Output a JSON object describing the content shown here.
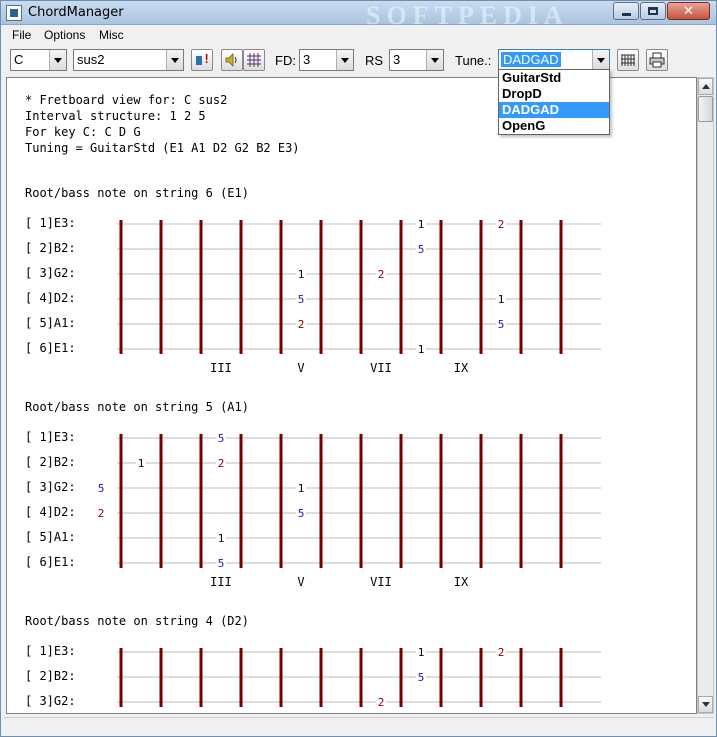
{
  "window": {
    "title": "ChordManager",
    "watermark": "SOFTPEDIA"
  },
  "menu": {
    "file": "File",
    "options": "Options",
    "misc": "Misc"
  },
  "toolbar": {
    "root_note": "C",
    "chord_type": "sus2",
    "fd_label": "FD:",
    "fd_value": "3",
    "rs_label": "RS",
    "rs_value": "3",
    "tune_label": "Tune.:",
    "tune_value": "DADGAD",
    "tune_options": [
      "GuitarStd",
      "DropD",
      "DADGAD",
      "OpenG"
    ],
    "tune_selected_index": 2
  },
  "info": [
    "* Fretboard view for: C sus2",
    "Interval structure: 1 2 5",
    "For key C: C D G",
    "Tuning = GuitarStd (E1 A1 D2 G2 B2 E3)"
  ],
  "colors": {
    "fret": "#7a0000",
    "string": "#bcbcbc",
    "root": "#000000",
    "second": "#8b0000",
    "fifth": "#1a1ab0",
    "selection": "#3399ff"
  },
  "sections": [
    {
      "title": "Root/bass note on string 6 (E1)",
      "strings": [
        "[ 1]E3:",
        "[ 2]B2:",
        "[ 3]G2:",
        "[ 4]D2:",
        "[ 5]A1:",
        "[ 6]E1:"
      ],
      "markers": [
        "III",
        "V",
        "VII",
        "IX"
      ],
      "notes": [
        {
          "s": 0,
          "f": 8,
          "t": "1"
        },
        {
          "s": 0,
          "f": 10,
          "t": "2"
        },
        {
          "s": 1,
          "f": 8,
          "t": "5"
        },
        {
          "s": 2,
          "f": 5,
          "t": "1"
        },
        {
          "s": 2,
          "f": 7,
          "t": "2"
        },
        {
          "s": 3,
          "f": 5,
          "t": "5"
        },
        {
          "s": 3,
          "f": 10,
          "t": "1"
        },
        {
          "s": 4,
          "f": 5,
          "t": "2"
        },
        {
          "s": 4,
          "f": 10,
          "t": "5"
        },
        {
          "s": 5,
          "f": 8,
          "t": "1"
        }
      ]
    },
    {
      "title": "Root/bass note on string 5 (A1)",
      "strings": [
        "[ 1]E3:",
        "[ 2]B2:",
        "[ 3]G2:",
        "[ 4]D2:",
        "[ 5]A1:",
        "[ 6]E1:"
      ],
      "markers": [
        "III",
        "V",
        "VII",
        "IX"
      ],
      "notes": [
        {
          "s": 0,
          "f": 3,
          "t": "5"
        },
        {
          "s": 1,
          "f": 1,
          "t": "1"
        },
        {
          "s": 1,
          "f": 3,
          "t": "2"
        },
        {
          "s": 2,
          "f": 0,
          "t": "5"
        },
        {
          "s": 2,
          "f": 5,
          "t": "1"
        },
        {
          "s": 3,
          "f": 0,
          "t": "2"
        },
        {
          "s": 3,
          "f": 5,
          "t": "5"
        },
        {
          "s": 4,
          "f": 3,
          "t": "1"
        },
        {
          "s": 5,
          "f": 3,
          "t": "5"
        }
      ]
    },
    {
      "title": "Root/bass note on string 4 (D2)",
      "strings": [
        "[ 1]E3:",
        "[ 2]B2:",
        "[ 3]G2:"
      ],
      "markers": [],
      "notes": [
        {
          "s": 0,
          "f": 8,
          "t": "1"
        },
        {
          "s": 0,
          "f": 10,
          "t": "2"
        },
        {
          "s": 1,
          "f": 8,
          "t": "5"
        },
        {
          "s": 2,
          "f": 7,
          "t": "2"
        }
      ]
    }
  ]
}
